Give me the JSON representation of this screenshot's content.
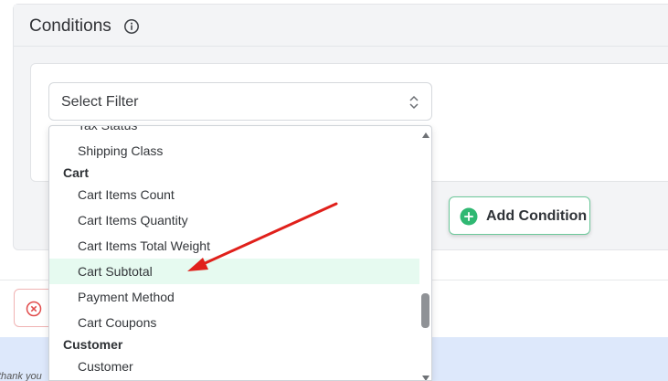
{
  "conditions": {
    "title": "Conditions",
    "select": {
      "placeholder": "Select Filter"
    },
    "add_button": {
      "label": "Add Condition"
    }
  },
  "dropdown": {
    "items": [
      {
        "type": "option",
        "label": "Tax Status"
      },
      {
        "type": "option",
        "label": "Shipping Class"
      },
      {
        "type": "group",
        "label": "Cart"
      },
      {
        "type": "option",
        "label": "Cart Items Count"
      },
      {
        "type": "option",
        "label": "Cart Items Quantity"
      },
      {
        "type": "option",
        "label": "Cart Items Total Weight"
      },
      {
        "type": "option",
        "label": "Cart Subtotal",
        "highlighted": true
      },
      {
        "type": "option",
        "label": "Payment Method"
      },
      {
        "type": "option",
        "label": "Cart Coupons"
      },
      {
        "type": "group",
        "label": "Customer"
      },
      {
        "type": "option",
        "label": "Customer"
      }
    ]
  },
  "footer": {
    "partial_text": "thank you"
  },
  "colors": {
    "accent_green": "#2fb872",
    "highlight_bg": "#e6faf0",
    "annotation_red": "#e0201b",
    "remove_red": "#e14b4b",
    "info_blue_bg": "#dde8fb"
  }
}
